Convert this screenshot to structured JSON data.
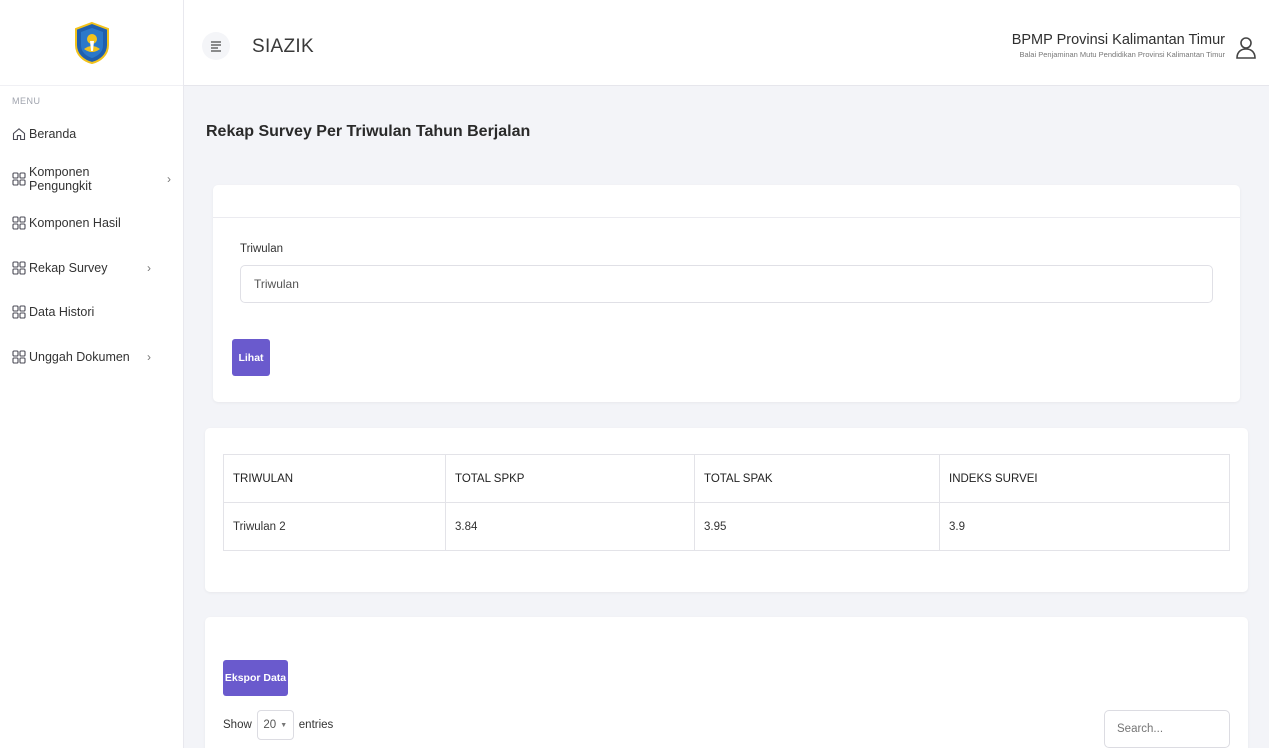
{
  "sidebar": {
    "menu_label": "MENU",
    "items": [
      {
        "label": "Beranda",
        "icon": "home-icon",
        "has_submenu": false
      },
      {
        "label": "Komponen Pengungkit",
        "icon": "grid-icon",
        "has_submenu": true
      },
      {
        "label": "Komponen Hasil",
        "icon": "grid-icon",
        "has_submenu": false
      },
      {
        "label": "Rekap Survey",
        "icon": "grid-icon",
        "has_submenu": true
      },
      {
        "label": "Data Histori",
        "icon": "grid-icon",
        "has_submenu": false
      },
      {
        "label": "Unggah Dokumen",
        "icon": "grid-icon",
        "has_submenu": true
      }
    ]
  },
  "header": {
    "app_title": "SIAZIK",
    "org_name": "BPMP Provinsi Kalimantan Timur",
    "org_subtitle": "Balai Penjaminan Mutu Pendidikan Provinsi Kalimantan Timur"
  },
  "main": {
    "page_title": "Rekap Survey Per Triwulan Tahun Berjalan",
    "filter": {
      "label": "Triwulan",
      "value": "Triwulan",
      "button_label": "Lihat"
    },
    "table": {
      "columns": [
        "TRIWULAN",
        "TOTAL SPKP",
        "TOTAL SPAK",
        "INDEKS SURVEI"
      ],
      "rows": [
        [
          "Triwulan 2",
          "3.84",
          "3.95",
          "3.9"
        ]
      ]
    },
    "export": {
      "button_label": "Ekspor Data",
      "show_label": "Show",
      "entries_value": "20",
      "entries_label": "entries",
      "search_placeholder": "Search..."
    }
  },
  "colors": {
    "accent": "#6a5acd",
    "background": "#f3f4f8",
    "logo_blue": "#1f5fae",
    "logo_yellow": "#f2c21b"
  }
}
